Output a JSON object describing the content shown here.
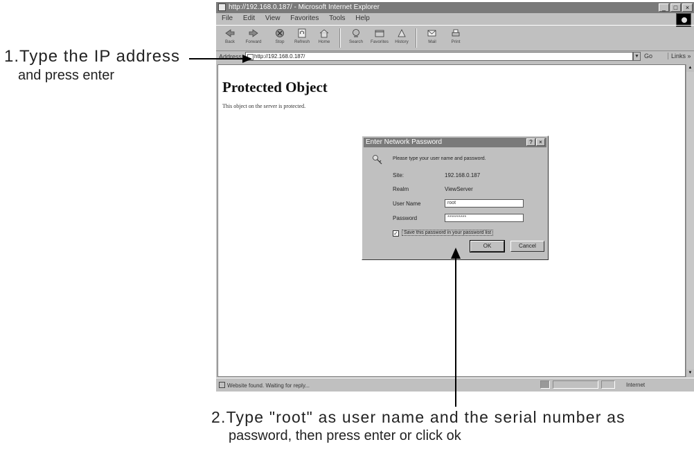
{
  "annotations": {
    "step1_line1": "1.Type the IP address",
    "step1_line2": "and press enter",
    "step2_line1": "2.Type \"root\" as user name and the serial number as",
    "step2_line2": "password, then press enter or click ok"
  },
  "browser": {
    "title": "http://192.168.0.187/ - Microsoft Internet Explorer",
    "window_buttons": [
      "_",
      "□",
      "×"
    ],
    "menu": [
      "File",
      "Edit",
      "View",
      "Favorites",
      "Tools",
      "Help"
    ],
    "toolbar": [
      {
        "label": "Back",
        "icon": "back-arrow-icon"
      },
      {
        "label": "Forward",
        "icon": "forward-arrow-icon"
      },
      {
        "label": "Stop",
        "icon": "stop-icon"
      },
      {
        "label": "Refresh",
        "icon": "refresh-icon"
      },
      {
        "label": "Home",
        "icon": "home-icon"
      },
      {
        "label": "Search",
        "icon": "search-icon"
      },
      {
        "label": "Favorites",
        "icon": "favorites-icon"
      },
      {
        "label": "History",
        "icon": "history-icon"
      },
      {
        "label": "Mail",
        "icon": "mail-icon"
      },
      {
        "label": "Print",
        "icon": "print-icon"
      }
    ],
    "address_label": "Address",
    "address_value": "http://192.168.0.187/",
    "go_label": "Go",
    "links_label": "Links »",
    "page_heading": "Protected Object",
    "page_text": "This object on the server is protected.",
    "status_text": "Website found. Waiting for reply...",
    "zone_text": "Internet"
  },
  "dialog": {
    "title": "Enter Network Password",
    "title_buttons": [
      "?",
      "×"
    ],
    "prompt": "Please type your user name and password.",
    "site_label": "Site:",
    "site_value": "192.168.0.187",
    "realm_label": "Realm",
    "realm_value": "ViewServer",
    "user_label": "User Name",
    "user_value": "root",
    "password_label": "Password",
    "password_value": "**********",
    "save_password_label": "Save this password in your password list",
    "save_password_checked": true,
    "ok_label": "OK",
    "cancel_label": "Cancel"
  },
  "colors": {
    "titlebar": "#7a7a7a",
    "chrome": "#c0c0c0",
    "content_bg": "#ffffff"
  }
}
